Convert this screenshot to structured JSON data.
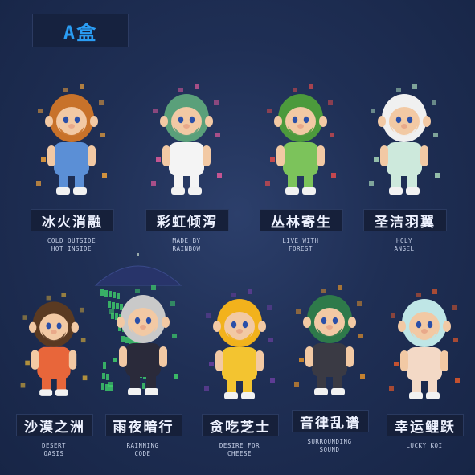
{
  "badge": {
    "text": "A盒"
  },
  "figures": [
    {
      "name_cn": "冰火消融",
      "sub": [
        "COLD OUTSIDE",
        "HOT INSIDE"
      ],
      "colors": {
        "face": "#f2c9a4",
        "hair": "#c8722a",
        "body": "#5b8fd6",
        "accent": "#f0a23a"
      }
    },
    {
      "name_cn": "彩虹倾泻",
      "sub": [
        "MADE BY",
        "RAINBOW"
      ],
      "colors": {
        "face": "#f2c9a4",
        "hair": "#5aa07a",
        "body": "#f4f4f4",
        "accent": "#e05a9a"
      }
    },
    {
      "name_cn": "丛林寄生",
      "sub": [
        "LIVE WITH",
        "FOREST"
      ],
      "colors": {
        "face": "#f2c9a4",
        "hair": "#4c9a3c",
        "body": "#7cc35b",
        "accent": "#e04b4b"
      }
    },
    {
      "name_cn": "圣洁羽翼",
      "sub": [
        "HOLY",
        "ANGEL"
      ],
      "colors": {
        "face": "#f2c9a4",
        "hair": "#f0f0f0",
        "body": "#cde9dc",
        "accent": "#a8d7b8"
      }
    },
    {
      "name_cn": "沙漠之洲",
      "sub": [
        "DESERT",
        "OASIS"
      ],
      "colors": {
        "face": "#f2c9a4",
        "hair": "#5a3a22",
        "body": "#e8663a",
        "accent": "#c9a13a"
      }
    },
    {
      "name_cn": "雨夜暗行",
      "sub": [
        "RAINNING",
        "CODE"
      ],
      "colors": {
        "face": "#f2c9a4",
        "hair": "#c9c9c9",
        "body": "#2a2a3a",
        "accent": "#3fd06a"
      }
    },
    {
      "name_cn": "贪吃芝士",
      "sub": [
        "DESIRE FOR",
        "CHEESE"
      ],
      "colors": {
        "face": "#f2c9a4",
        "hair": "#f2b21c",
        "body": "#f3c430",
        "accent": "#6a3ea0"
      }
    },
    {
      "name_cn": "音律乱谱",
      "sub": [
        "SURROUNDING",
        "SOUND"
      ],
      "colors": {
        "face": "#f2c9a4",
        "hair": "#2e7a4a",
        "body": "#3a3a44",
        "accent": "#e0902a"
      }
    },
    {
      "name_cn": "幸运鲤跃",
      "sub": [
        "LUCKY KOI"
      ],
      "colors": {
        "face": "#f2c9a4",
        "hair": "#bfe6e6",
        "body": "#f3d9c6",
        "accent": "#e2582a"
      }
    }
  ]
}
